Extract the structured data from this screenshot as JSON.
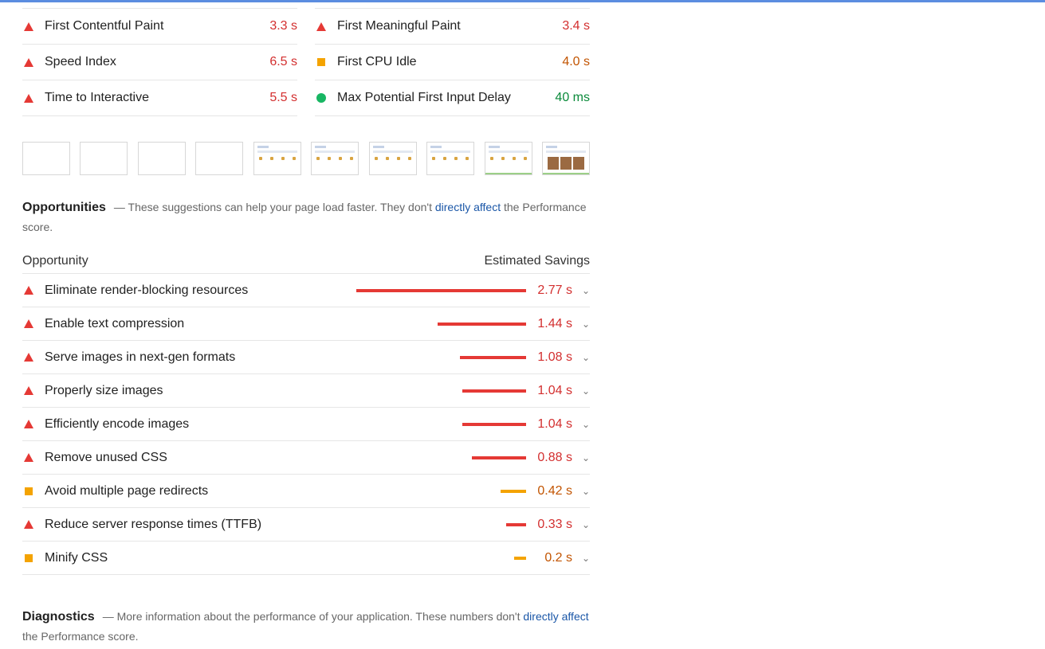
{
  "metrics": [
    {
      "label": "First Contentful Paint",
      "value": "3.3 s",
      "status": "fail"
    },
    {
      "label": "First Meaningful Paint",
      "value": "3.4 s",
      "status": "fail"
    },
    {
      "label": "Speed Index",
      "value": "6.5 s",
      "status": "fail"
    },
    {
      "label": "First CPU Idle",
      "value": "4.0 s",
      "status": "average"
    },
    {
      "label": "Time to Interactive",
      "value": "5.5 s",
      "status": "fail"
    },
    {
      "label": "Max Potential First Input Delay",
      "value": "40 ms",
      "status": "pass"
    }
  ],
  "filmstrip_frames": 10,
  "opportunities": {
    "title": "Opportunities",
    "desc_before": "These suggestions can help your page load faster. They don't ",
    "link": "directly affect",
    "desc_after": " the Performance score.",
    "col_opportunity": "Opportunity",
    "col_savings": "Estimated Savings",
    "items": [
      {
        "label": "Eliminate render-blocking resources",
        "savings": "2.77 s",
        "seconds": 2.77,
        "status": "fail"
      },
      {
        "label": "Enable text compression",
        "savings": "1.44 s",
        "seconds": 1.44,
        "status": "fail"
      },
      {
        "label": "Serve images in next-gen formats",
        "savings": "1.08 s",
        "seconds": 1.08,
        "status": "fail"
      },
      {
        "label": "Properly size images",
        "savings": "1.04 s",
        "seconds": 1.04,
        "status": "fail"
      },
      {
        "label": "Efficiently encode images",
        "savings": "1.04 s",
        "seconds": 1.04,
        "status": "fail"
      },
      {
        "label": "Remove unused CSS",
        "savings": "0.88 s",
        "seconds": 0.88,
        "status": "fail"
      },
      {
        "label": "Avoid multiple page redirects",
        "savings": "0.42 s",
        "seconds": 0.42,
        "status": "average"
      },
      {
        "label": "Reduce server response times (TTFB)",
        "savings": "0.33 s",
        "seconds": 0.33,
        "status": "fail"
      },
      {
        "label": "Minify CSS",
        "savings": "0.2 s",
        "seconds": 0.2,
        "status": "average"
      }
    ]
  },
  "diagnostics": {
    "title": "Diagnostics",
    "desc_before": "More information about the performance of your application. These numbers don't ",
    "link": "directly affect",
    "desc_after": " the Performance score."
  },
  "colors": {
    "fail": "#e53935",
    "average": "#f4a300",
    "pass": "#18b663",
    "link": "#1a56a7"
  }
}
